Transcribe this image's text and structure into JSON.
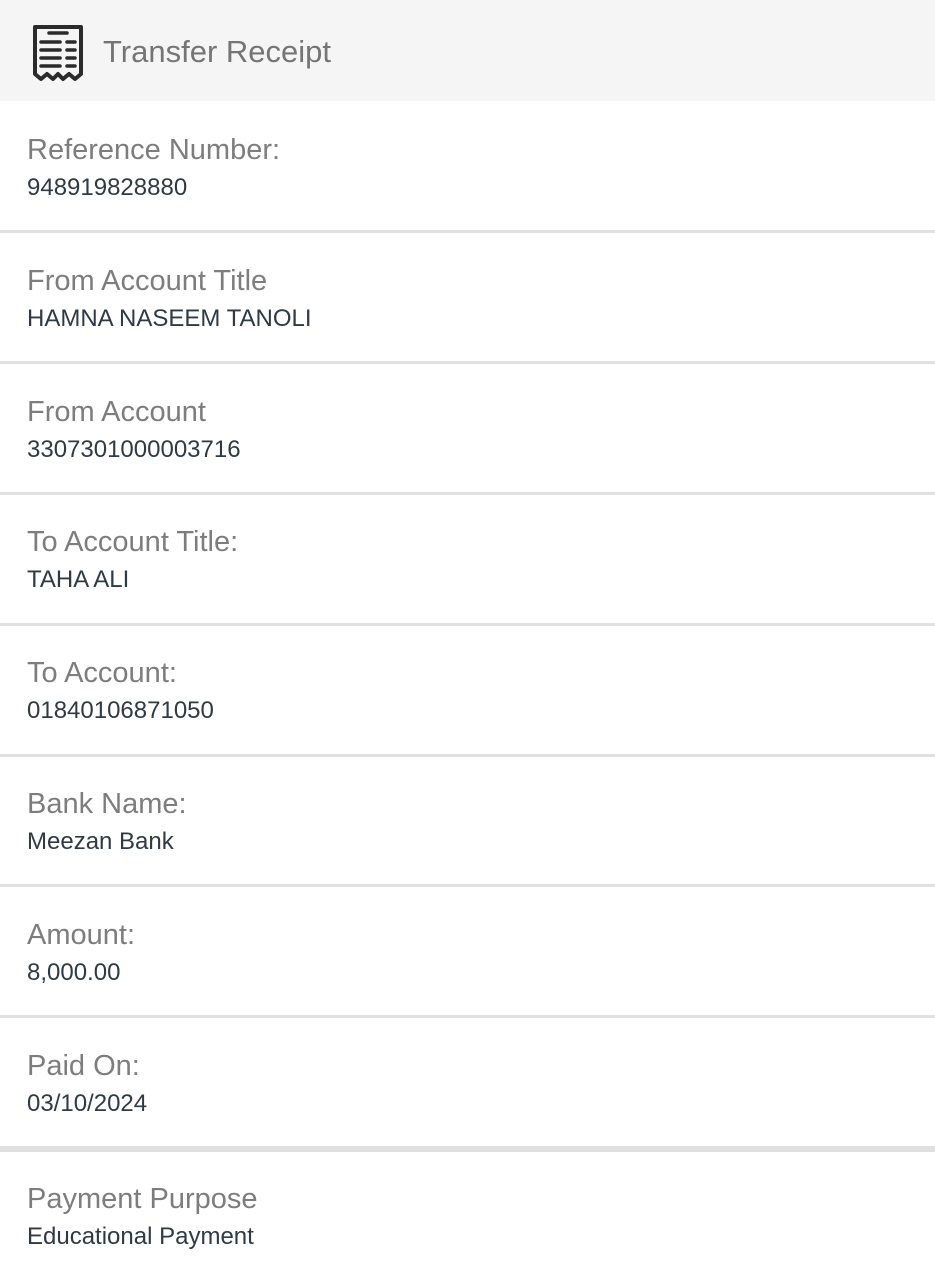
{
  "header": {
    "title": "Transfer Receipt",
    "icon": "receipt-icon"
  },
  "fields": {
    "reference_number": {
      "label": "Reference Number:",
      "value": "948919828880"
    },
    "from_account_title": {
      "label": "From Account Title",
      "value": "HAMNA NASEEM TANOLI"
    },
    "from_account": {
      "label": "From Account",
      "value": "3307301000003716"
    },
    "to_account_title": {
      "label": "To Account Title:",
      "value": "TAHA ALI"
    },
    "to_account": {
      "label": "To Account:",
      "value": "01840106871050"
    },
    "bank_name": {
      "label": "Bank Name:",
      "value": "Meezan Bank"
    },
    "amount": {
      "label": "Amount:",
      "value": "8,000.00"
    },
    "paid_on": {
      "label": "Paid On:",
      "value": "03/10/2024"
    },
    "payment_purpose": {
      "label": "Payment Purpose",
      "value": "Educational Payment"
    }
  },
  "colors": {
    "header_bg": "#f5f5f5",
    "label": "#7d7d7d",
    "value": "#2f3a44",
    "divider": "#e0e0e0",
    "icon": "#2b2b2b"
  }
}
